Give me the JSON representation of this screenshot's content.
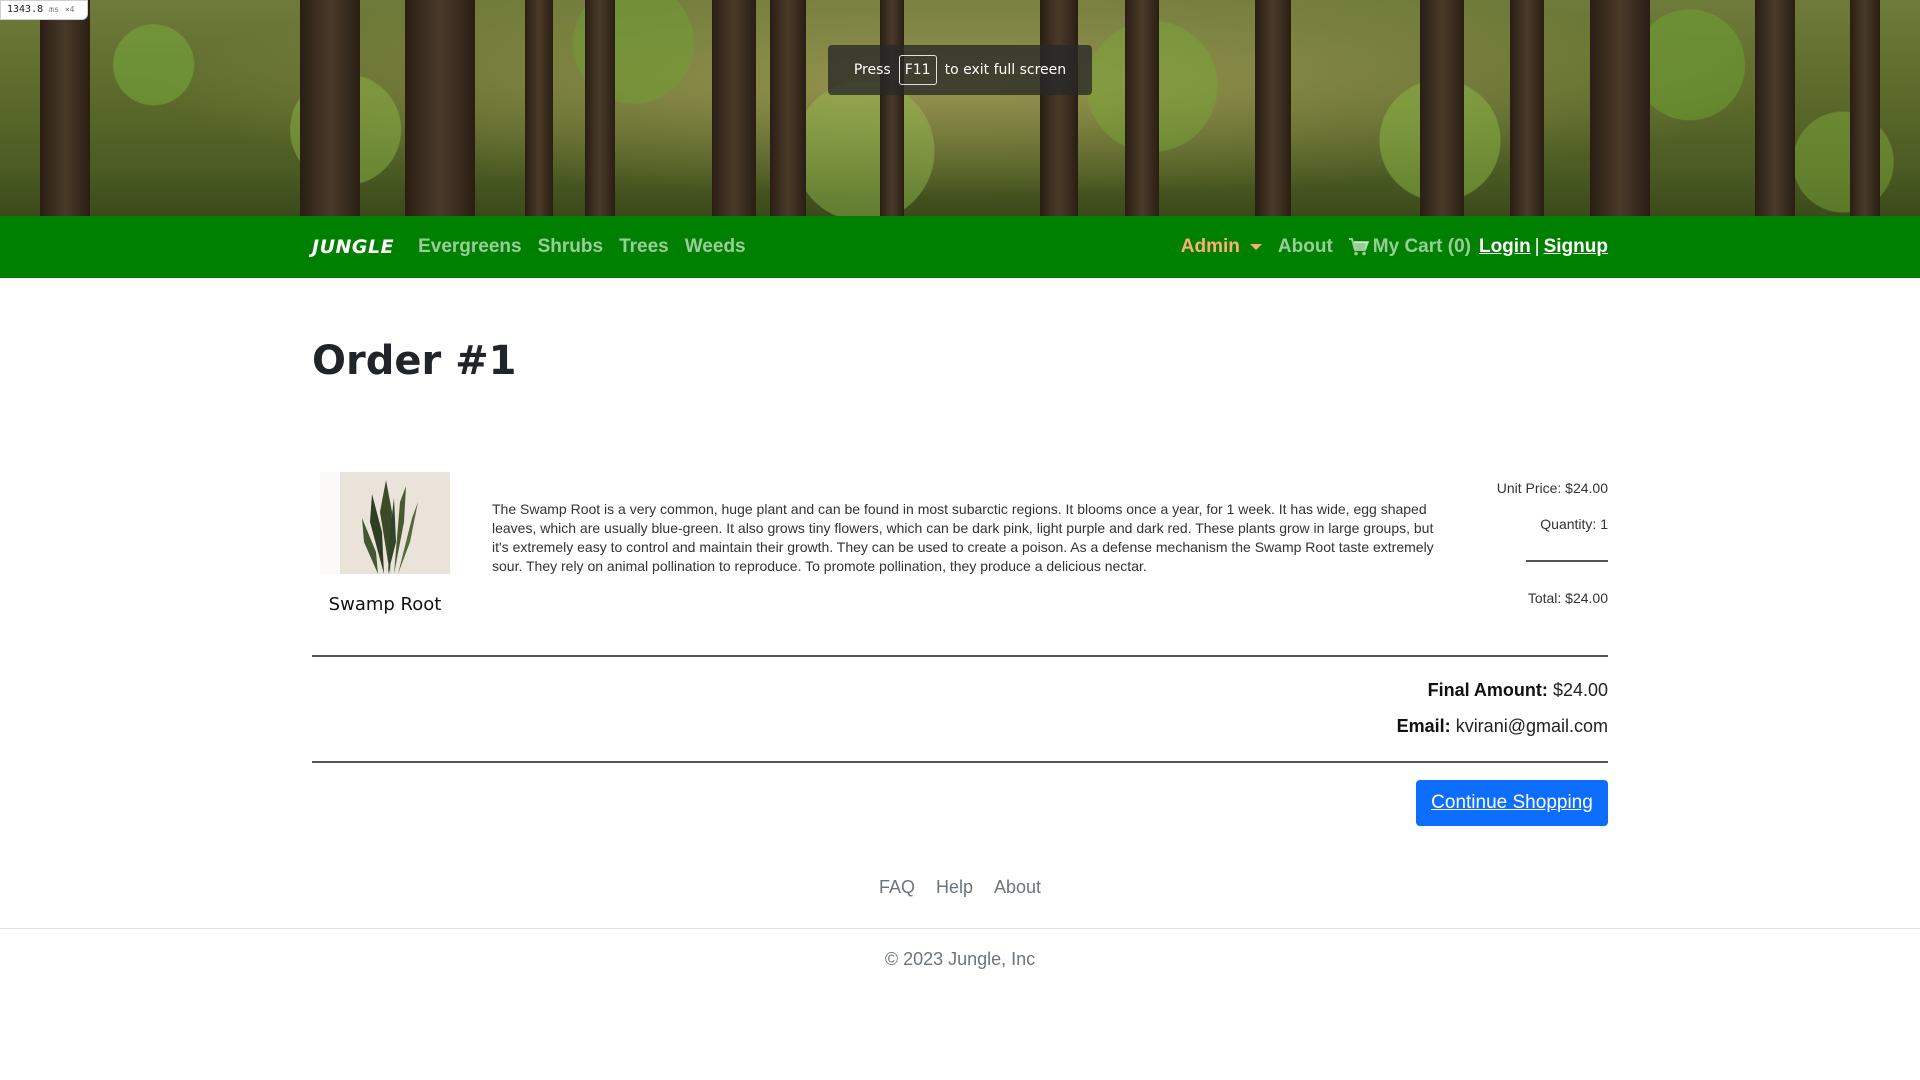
{
  "perf_badge": {
    "value": "1343.8",
    "unit": "ms",
    "multiplier": "×4"
  },
  "fullscreen_toast": {
    "press": "Press",
    "key": "F11",
    "rest": "to exit full screen"
  },
  "navbar": {
    "brand": "JUNGLE",
    "categories": [
      "Evergreens",
      "Shrubs",
      "Trees",
      "Weeds"
    ],
    "admin_label": "Admin",
    "about_label": "About",
    "cart_label": "My Cart (0)",
    "login_label": "Login",
    "separator": "|",
    "signup_label": "Signup",
    "colors": {
      "bar": "#008000",
      "admin": "#ffb070"
    }
  },
  "order": {
    "title": "Order #1",
    "item": {
      "name": "Swamp Root",
      "description": "The Swamp Root is a very common, huge plant and can be found in most subarctic regions. It blooms once a year, for 1 week. It has wide, egg shaped leaves, which are usually blue-green. It also grows tiny flowers, which can be dark pink, light purple and dark red. These plants grow in large groups, but it's extremely easy to control and maintain their growth. They can be used to create a poison. As a defense mechanism the Swamp Root taste extremely sour. They rely on animal pollination to reproduce. To promote pollination, they produce a delicious nectar.",
      "unit_price": "Unit Price: $24.00",
      "quantity": "Quantity: 1",
      "total": "Total: $24.00"
    },
    "final_amount_label": "Final Amount:",
    "final_amount_value": "$24.00",
    "email_label": "Email:",
    "email_value": "kvirani@gmail.com",
    "continue_button": "Continue Shopping"
  },
  "footer": {
    "links": [
      "FAQ",
      "Help",
      "About"
    ],
    "copyright": "© 2023 Jungle, Inc"
  }
}
